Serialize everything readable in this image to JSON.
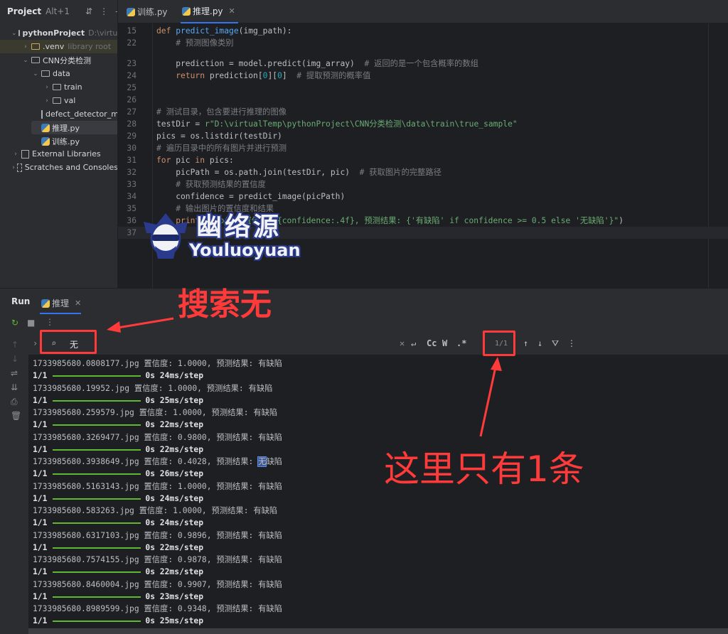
{
  "project_panel": {
    "title": "Project",
    "shortcut": "Alt+1",
    "tree": [
      {
        "label": "pythonProject",
        "extra": "D:\\virtualT"
      },
      {
        "label": ".venv",
        "extra": "library root"
      },
      {
        "label": "CNN分类检测",
        "extra": ""
      },
      {
        "label": "data",
        "extra": ""
      },
      {
        "label": "train",
        "extra": ""
      },
      {
        "label": "val",
        "extra": ""
      },
      {
        "label": "defect_detector_mc",
        "extra": ""
      },
      {
        "label": "推理.py",
        "extra": ""
      },
      {
        "label": "训练.py",
        "extra": ""
      },
      {
        "label": "External Libraries",
        "extra": ""
      },
      {
        "label": "Scratches and Consoles",
        "extra": ""
      }
    ]
  },
  "editor": {
    "tabs": [
      {
        "label": "训练.py"
      },
      {
        "label": "推理.py"
      }
    ],
    "lines": [
      {
        "n": "15",
        "text": "def predict_image(img_path):"
      },
      {
        "n": "22",
        "text": "    # 预测图像类别"
      },
      {
        "n": "23",
        "text": "    prediction = model.predict(img_array)  # 返回的是一个包含概率的数组"
      },
      {
        "n": "24",
        "text": "    return prediction[0][0]  # 提取预测的概率值"
      },
      {
        "n": "25",
        "text": ""
      },
      {
        "n": "26",
        "text": ""
      },
      {
        "n": "27",
        "text": "# 测试目录，包含要进行推理的图像"
      },
      {
        "n": "28",
        "text": "testDir = r\"D:\\virtualTemp\\pythonProject\\CNN分类检测\\data\\train\\true_sample\""
      },
      {
        "n": "29",
        "text": "pics = os.listdir(testDir)"
      },
      {
        "n": "30",
        "text": "# 遍历目录中的所有图片并进行预测"
      },
      {
        "n": "31",
        "text": "for pic in pics:"
      },
      {
        "n": "32",
        "text": "    picPath = os.path.join(testDir, pic)  # 获取图片的完整路径"
      },
      {
        "n": "33",
        "text": "    # 获取预测结果的置信度"
      },
      {
        "n": "34",
        "text": "    confidence = predict_image(picPath)"
      },
      {
        "n": "35",
        "text": "    # 输出图片的置信度和结果"
      },
      {
        "n": "36",
        "text": "    print(f\"{pic} 置信度: {confidence:.4f}, 预测结果: {'有缺陷' if confidence >= 0.5 else '无缺陷'}\")"
      },
      {
        "n": "37",
        "text": ""
      }
    ]
  },
  "watermark": {
    "cn": "幽络源",
    "en": "Youluoyuan"
  },
  "run_panel": {
    "title": "Run",
    "tab": "推理",
    "search": {
      "value": "无",
      "match_count": "1/1",
      "case_label": "Cc",
      "word_label": "W",
      "regex_label": ".*"
    },
    "output": [
      {
        "kind": "res",
        "text": "1733985680.0808177.jpg 置信度: 1.0000, 预测结果: 有缺陷"
      },
      {
        "kind": "step",
        "prefix": "1/1",
        "suffix": "0s 24ms/step"
      },
      {
        "kind": "res",
        "text": "1733985680.19952.jpg 置信度: 1.0000, 预测结果: 有缺陷"
      },
      {
        "kind": "step",
        "prefix": "1/1",
        "suffix": "0s 25ms/step"
      },
      {
        "kind": "res",
        "text": "1733985680.259579.jpg 置信度: 1.0000, 预测结果: 有缺陷"
      },
      {
        "kind": "step",
        "prefix": "1/1",
        "suffix": "0s 22ms/step"
      },
      {
        "kind": "res",
        "text": "1733985680.3269477.jpg 置信度: 0.9800, 预测结果: 有缺陷"
      },
      {
        "kind": "step",
        "prefix": "1/1",
        "suffix": "0s 22ms/step"
      },
      {
        "kind": "res_hl",
        "before": "1733985680.3938649.jpg 置信度: 0.4028, 预测结果: ",
        "hl": "无",
        "after": "缺陷"
      },
      {
        "kind": "step",
        "prefix": "1/1",
        "suffix": "0s 26ms/step"
      },
      {
        "kind": "res",
        "text": "1733985680.5163143.jpg 置信度: 1.0000, 预测结果: 有缺陷"
      },
      {
        "kind": "step",
        "prefix": "1/1",
        "suffix": "0s 24ms/step"
      },
      {
        "kind": "res",
        "text": "1733985680.583263.jpg 置信度: 1.0000, 预测结果: 有缺陷"
      },
      {
        "kind": "step",
        "prefix": "1/1",
        "suffix": "0s 24ms/step"
      },
      {
        "kind": "res",
        "text": "1733985680.6317103.jpg 置信度: 0.9896, 预测结果: 有缺陷"
      },
      {
        "kind": "step",
        "prefix": "1/1",
        "suffix": "0s 22ms/step"
      },
      {
        "kind": "res",
        "text": "1733985680.7574155.jpg 置信度: 0.9878, 预测结果: 有缺陷"
      },
      {
        "kind": "step",
        "prefix": "1/1",
        "suffix": "0s 22ms/step"
      },
      {
        "kind": "res",
        "text": "1733985680.8460004.jpg 置信度: 0.9907, 预测结果: 有缺陷"
      },
      {
        "kind": "step",
        "prefix": "1/1",
        "suffix": "0s 23ms/step"
      },
      {
        "kind": "res",
        "text": "1733985680.8989599.jpg 置信度: 0.9348, 预测结果: 有缺陷"
      },
      {
        "kind": "step",
        "prefix": "1/1",
        "suffix": "0s 25ms/step"
      }
    ]
  },
  "annotations": {
    "search_note": "搜索无",
    "count_note": "这里只有1条"
  },
  "colors": {
    "accent": "#3574f0",
    "annotation": "#ff3a3a",
    "progress": "#5fb832"
  }
}
